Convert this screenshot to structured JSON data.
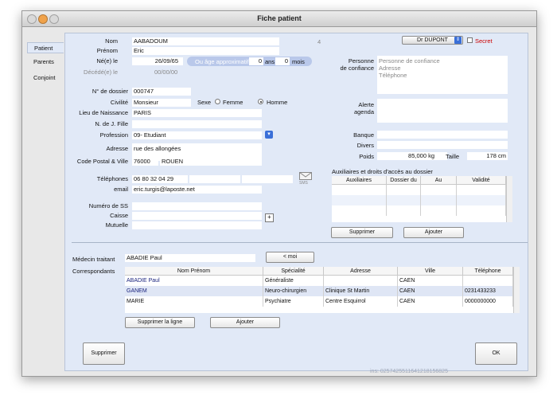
{
  "window": {
    "title": "Fiche patient"
  },
  "tabs": [
    "Patient",
    "Parents",
    "Conjoint"
  ],
  "identity": {
    "nom_label": "Nom",
    "nom": "AABADOUM",
    "counter": "4",
    "prenom_label": "Prénom",
    "prenom": "Eric",
    "ne_label": "Né(e) le",
    "ne": "26/09/65",
    "age_label": "Ou âge approximatif",
    "age_ans": "0",
    "ans_label": "ans",
    "age_mois": "0",
    "mois_label": "mois",
    "decede_label": "Décédé(e) le",
    "decede": "00/00/00"
  },
  "dossier": {
    "num_label": "N° de dossier",
    "num": "000747",
    "civilite_label": "Civilité",
    "civilite": "Monsieur",
    "sexe_label": "Sexe",
    "femme_label": "Femme",
    "homme_label": "Homme",
    "sexe_selected": "Homme",
    "lieu_label": "Lieu de Naissance",
    "lieu": "PARIS",
    "fille_label": "N. de J. Fille",
    "fille": "",
    "profession_label": "Profession",
    "profession": "09- Etudiant",
    "adresse_label": "Adresse",
    "adresse": "rue des allongées",
    "cp_label": "Code Postal & Ville",
    "cp": "76000",
    "ville": "ROUEN",
    "tel_label": "Téléphones",
    "tel1": "06 80 32 04 29",
    "sms_label": "SMS",
    "email_label": "email",
    "email": "eric.turgis@laposte.net",
    "ss_label": "Numéro de SS",
    "caisse_label": "Caisse",
    "mutuelle_label": "Mutuelle"
  },
  "right": {
    "doctor": "Dr DUPONT",
    "secret_label": "Secret",
    "confiance_label_1": "Personne",
    "confiance_label_2": "de confiance",
    "confiance_lines": [
      "Personne de confiance",
      "Adresse",
      "Téléphone"
    ],
    "alerte_label_1": "Alerte",
    "alerte_label_2": "agenda",
    "banque_label": "Banque",
    "divers_label": "Divers",
    "poids_label": "Poids",
    "poids": "85,000 kg",
    "taille_label": "Taille",
    "taille": "178 cm"
  },
  "aux": {
    "title": "Auxiliaires et droits d'accès au dossier",
    "columns": [
      "Auxiliaires",
      "Dossier du",
      "Au",
      "Validité"
    ],
    "supprimer": "Supprimer",
    "ajouter": "Ajouter"
  },
  "medecin": {
    "label": "Médecin traitant",
    "value": "ABADIE Paul",
    "moi_button": "< moi"
  },
  "correspondants": {
    "label": "Correspondants",
    "columns": [
      "Nom Prénom",
      "Spécialité",
      "Adresse",
      "Ville",
      "Téléphone"
    ],
    "rows": [
      [
        "ABADIE Paul",
        "Généraliste",
        "",
        "CAEN",
        ""
      ],
      [
        "GANEM",
        "Neuro-chirurgien",
        "Clinique St Martin",
        "CAEN",
        "0231433233"
      ],
      [
        "MARIE",
        "Psychiatre",
        "Centre Esquirrol",
        "CAEN",
        "0000000000"
      ]
    ],
    "supprimer_ligne": "Supprimer la ligne",
    "ajouter": "Ajouter"
  },
  "footer": {
    "supprimer": "Supprimer",
    "ok": "OK",
    "ins": "ins: 0257425511641218156825"
  },
  "colors": {
    "panel": "#e1e9f7",
    "pill": "#b9c8ea",
    "secret": "#cc0000",
    "link": "#1a237e"
  }
}
